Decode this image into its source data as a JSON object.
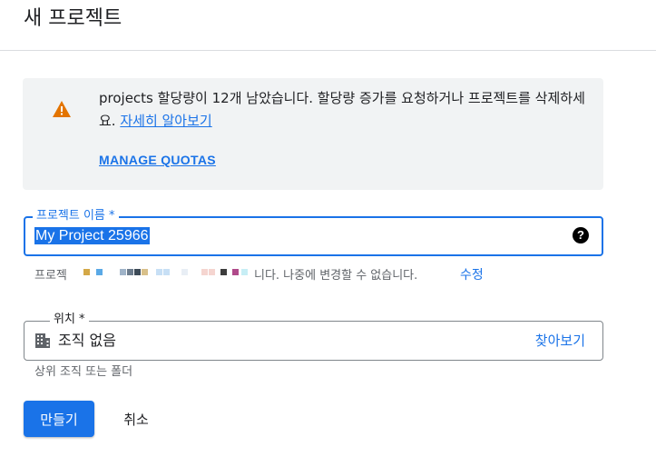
{
  "page": {
    "title": "새 프로젝트"
  },
  "alert": {
    "icon": "warning-icon",
    "text_before": "projects 할당량이 12개 남았습니다. 할당량 증가를 요청하거나 프로젝트를 삭제하세요. ",
    "learn_more": "자세히 알아보기",
    "manage_quotas": "MANAGE QUOTAS"
  },
  "project_name": {
    "label": "프로젝트 이름 *",
    "value": "My Project 25966",
    "help_icon": "help-icon"
  },
  "project_id": {
    "prefix": "프로젝",
    "suffix": "니다. 나중에 변경할 수 없습니다.",
    "edit_label": "수정"
  },
  "location": {
    "label": "위치 *",
    "icon": "organization-icon",
    "value": "조직 없음",
    "browse_label": "찾아보기",
    "helper": "상위 조직 또는 폴더"
  },
  "actions": {
    "create_label": "만들기",
    "cancel_label": "취소"
  },
  "colors": {
    "accent": "#1a73e8",
    "warning": "#e37400",
    "alert_bg": "#f1f3f4"
  }
}
